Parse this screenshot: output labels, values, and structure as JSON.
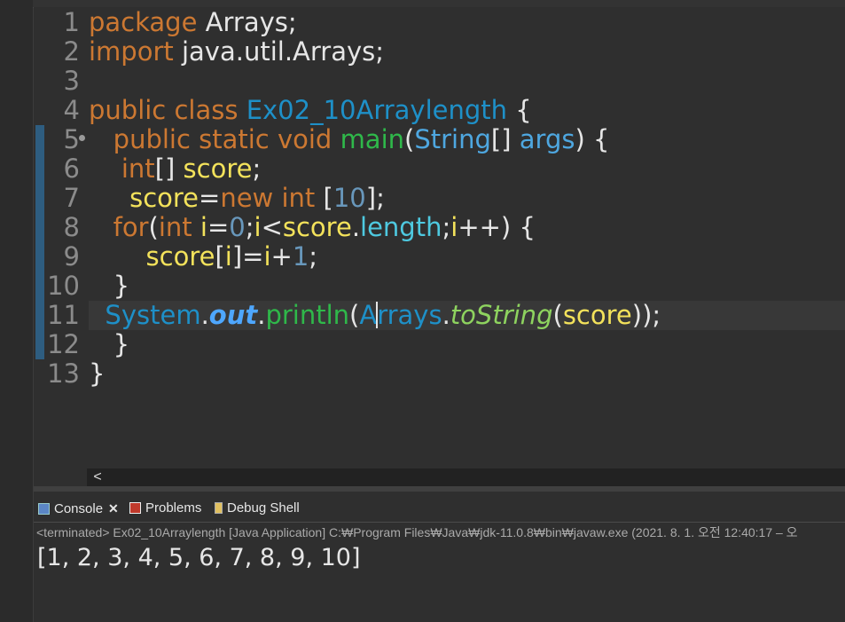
{
  "editor": {
    "line_numbers": [
      "1",
      "2",
      "3",
      "4",
      "5",
      "6",
      "7",
      "8",
      "9",
      "10",
      "11",
      "12",
      "13"
    ],
    "lines": [
      [
        {
          "t": "package",
          "c": "kw"
        },
        {
          "t": " Arrays;",
          "c": "pl"
        }
      ],
      [
        {
          "t": "import",
          "c": "kw"
        },
        {
          "t": " java.util.Arrays;",
          "c": "pl"
        }
      ],
      [],
      [
        {
          "t": "public class ",
          "c": "kw"
        },
        {
          "t": "Ex02_10Arraylength",
          "c": "cls"
        },
        {
          "t": " {",
          "c": "pl"
        }
      ],
      [
        {
          "t": "   public static void ",
          "c": "kw"
        },
        {
          "t": "main",
          "c": "mth"
        },
        {
          "t": "(",
          "c": "pl"
        },
        {
          "t": "String",
          "c": "typ"
        },
        {
          "t": "[] ",
          "c": "pl"
        },
        {
          "t": "args",
          "c": "typ"
        },
        {
          "t": ") {",
          "c": "pl"
        }
      ],
      [
        {
          "t": "    int",
          "c": "kw"
        },
        {
          "t": "[] ",
          "c": "pl"
        },
        {
          "t": "score",
          "c": "var"
        },
        {
          "t": ";",
          "c": "pl"
        }
      ],
      [
        {
          "t": "     score",
          "c": "var"
        },
        {
          "t": "=",
          "c": "pl"
        },
        {
          "t": "new int",
          "c": "kw"
        },
        {
          "t": " [",
          "c": "pl"
        },
        {
          "t": "10",
          "c": "num"
        },
        {
          "t": "];",
          "c": "pl"
        }
      ],
      [
        {
          "t": "   for",
          "c": "kw"
        },
        {
          "t": "(",
          "c": "pl"
        },
        {
          "t": "int",
          "c": "kw"
        },
        {
          "t": " i",
          "c": "var"
        },
        {
          "t": "=",
          "c": "pl"
        },
        {
          "t": "0",
          "c": "num"
        },
        {
          "t": ";",
          "c": "pl"
        },
        {
          "t": "i",
          "c": "var"
        },
        {
          "t": "<",
          "c": "pl"
        },
        {
          "t": "score",
          "c": "var"
        },
        {
          "t": ".",
          "c": "pl"
        },
        {
          "t": "length",
          "c": "fld"
        },
        {
          "t": ";",
          "c": "pl"
        },
        {
          "t": "i",
          "c": "var"
        },
        {
          "t": "++) {",
          "c": "pl"
        }
      ],
      [
        {
          "t": "       score",
          "c": "var"
        },
        {
          "t": "[",
          "c": "pl"
        },
        {
          "t": "i",
          "c": "var"
        },
        {
          "t": "]=",
          "c": "pl"
        },
        {
          "t": "i",
          "c": "var"
        },
        {
          "t": "+",
          "c": "pl"
        },
        {
          "t": "1",
          "c": "num"
        },
        {
          "t": ";",
          "c": "pl"
        }
      ],
      [
        {
          "t": "   }",
          "c": "pl"
        }
      ],
      [
        {
          "t": "  System",
          "c": "cls"
        },
        {
          "t": ".",
          "c": "pl"
        },
        {
          "t": "out",
          "c": "sfld"
        },
        {
          "t": ".",
          "c": "pl"
        },
        {
          "t": "println",
          "c": "mth"
        },
        {
          "t": "(",
          "c": "pl"
        },
        {
          "t": "A",
          "c": "cls"
        },
        {
          "caret": true
        },
        {
          "t": "rrays",
          "c": "cls"
        },
        {
          "t": ".",
          "c": "pl"
        },
        {
          "t": "toString",
          "c": "sm"
        },
        {
          "t": "(",
          "c": "pl"
        },
        {
          "t": "score",
          "c": "var"
        },
        {
          "t": "));",
          "c": "pl"
        }
      ],
      [
        {
          "t": "   }",
          "c": "pl"
        }
      ],
      [
        {
          "t": "}",
          "c": "pl"
        }
      ]
    ]
  },
  "console": {
    "tabs": [
      {
        "label": "Console",
        "icon": "console-icon",
        "active": true,
        "close": "✕"
      },
      {
        "label": "Problems",
        "icon": "problems-icon"
      },
      {
        "label": "Debug Shell",
        "icon": "debug-shell-icon"
      }
    ],
    "status": "<terminated> Ex02_10Arraylength [Java Application] C:₩Program Files₩Java₩jdk-11.0.8₩bin₩javaw.exe  (2021. 8. 1. 오전 12:40:17 – 오",
    "output": "[1, 2, 3, 4, 5, 6, 7, 8, 9, 10]"
  },
  "scroll_arrow": "<"
}
